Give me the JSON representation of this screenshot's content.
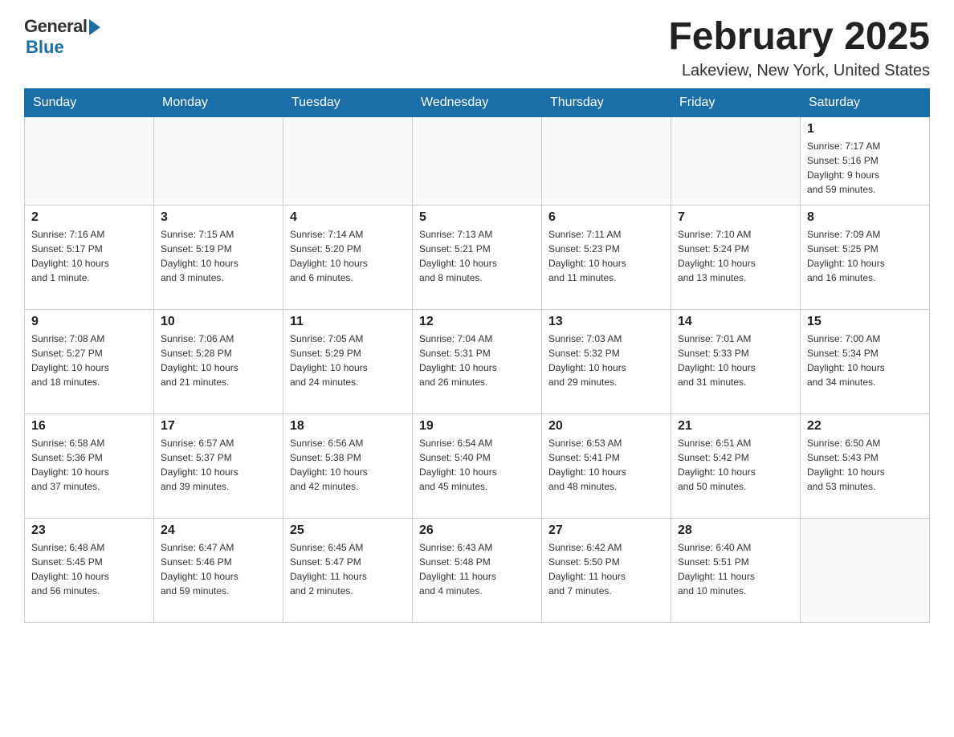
{
  "logo": {
    "general": "General",
    "blue": "Blue"
  },
  "header": {
    "title": "February 2025",
    "location": "Lakeview, New York, United States"
  },
  "weekdays": [
    "Sunday",
    "Monday",
    "Tuesday",
    "Wednesday",
    "Thursday",
    "Friday",
    "Saturday"
  ],
  "weeks": [
    [
      {
        "day": "",
        "info": ""
      },
      {
        "day": "",
        "info": ""
      },
      {
        "day": "",
        "info": ""
      },
      {
        "day": "",
        "info": ""
      },
      {
        "day": "",
        "info": ""
      },
      {
        "day": "",
        "info": ""
      },
      {
        "day": "1",
        "info": "Sunrise: 7:17 AM\nSunset: 5:16 PM\nDaylight: 9 hours\nand 59 minutes."
      }
    ],
    [
      {
        "day": "2",
        "info": "Sunrise: 7:16 AM\nSunset: 5:17 PM\nDaylight: 10 hours\nand 1 minute."
      },
      {
        "day": "3",
        "info": "Sunrise: 7:15 AM\nSunset: 5:19 PM\nDaylight: 10 hours\nand 3 minutes."
      },
      {
        "day": "4",
        "info": "Sunrise: 7:14 AM\nSunset: 5:20 PM\nDaylight: 10 hours\nand 6 minutes."
      },
      {
        "day": "5",
        "info": "Sunrise: 7:13 AM\nSunset: 5:21 PM\nDaylight: 10 hours\nand 8 minutes."
      },
      {
        "day": "6",
        "info": "Sunrise: 7:11 AM\nSunset: 5:23 PM\nDaylight: 10 hours\nand 11 minutes."
      },
      {
        "day": "7",
        "info": "Sunrise: 7:10 AM\nSunset: 5:24 PM\nDaylight: 10 hours\nand 13 minutes."
      },
      {
        "day": "8",
        "info": "Sunrise: 7:09 AM\nSunset: 5:25 PM\nDaylight: 10 hours\nand 16 minutes."
      }
    ],
    [
      {
        "day": "9",
        "info": "Sunrise: 7:08 AM\nSunset: 5:27 PM\nDaylight: 10 hours\nand 18 minutes."
      },
      {
        "day": "10",
        "info": "Sunrise: 7:06 AM\nSunset: 5:28 PM\nDaylight: 10 hours\nand 21 minutes."
      },
      {
        "day": "11",
        "info": "Sunrise: 7:05 AM\nSunset: 5:29 PM\nDaylight: 10 hours\nand 24 minutes."
      },
      {
        "day": "12",
        "info": "Sunrise: 7:04 AM\nSunset: 5:31 PM\nDaylight: 10 hours\nand 26 minutes."
      },
      {
        "day": "13",
        "info": "Sunrise: 7:03 AM\nSunset: 5:32 PM\nDaylight: 10 hours\nand 29 minutes."
      },
      {
        "day": "14",
        "info": "Sunrise: 7:01 AM\nSunset: 5:33 PM\nDaylight: 10 hours\nand 31 minutes."
      },
      {
        "day": "15",
        "info": "Sunrise: 7:00 AM\nSunset: 5:34 PM\nDaylight: 10 hours\nand 34 minutes."
      }
    ],
    [
      {
        "day": "16",
        "info": "Sunrise: 6:58 AM\nSunset: 5:36 PM\nDaylight: 10 hours\nand 37 minutes."
      },
      {
        "day": "17",
        "info": "Sunrise: 6:57 AM\nSunset: 5:37 PM\nDaylight: 10 hours\nand 39 minutes."
      },
      {
        "day": "18",
        "info": "Sunrise: 6:56 AM\nSunset: 5:38 PM\nDaylight: 10 hours\nand 42 minutes."
      },
      {
        "day": "19",
        "info": "Sunrise: 6:54 AM\nSunset: 5:40 PM\nDaylight: 10 hours\nand 45 minutes."
      },
      {
        "day": "20",
        "info": "Sunrise: 6:53 AM\nSunset: 5:41 PM\nDaylight: 10 hours\nand 48 minutes."
      },
      {
        "day": "21",
        "info": "Sunrise: 6:51 AM\nSunset: 5:42 PM\nDaylight: 10 hours\nand 50 minutes."
      },
      {
        "day": "22",
        "info": "Sunrise: 6:50 AM\nSunset: 5:43 PM\nDaylight: 10 hours\nand 53 minutes."
      }
    ],
    [
      {
        "day": "23",
        "info": "Sunrise: 6:48 AM\nSunset: 5:45 PM\nDaylight: 10 hours\nand 56 minutes."
      },
      {
        "day": "24",
        "info": "Sunrise: 6:47 AM\nSunset: 5:46 PM\nDaylight: 10 hours\nand 59 minutes."
      },
      {
        "day": "25",
        "info": "Sunrise: 6:45 AM\nSunset: 5:47 PM\nDaylight: 11 hours\nand 2 minutes."
      },
      {
        "day": "26",
        "info": "Sunrise: 6:43 AM\nSunset: 5:48 PM\nDaylight: 11 hours\nand 4 minutes."
      },
      {
        "day": "27",
        "info": "Sunrise: 6:42 AM\nSunset: 5:50 PM\nDaylight: 11 hours\nand 7 minutes."
      },
      {
        "day": "28",
        "info": "Sunrise: 6:40 AM\nSunset: 5:51 PM\nDaylight: 11 hours\nand 10 minutes."
      },
      {
        "day": "",
        "info": ""
      }
    ]
  ]
}
